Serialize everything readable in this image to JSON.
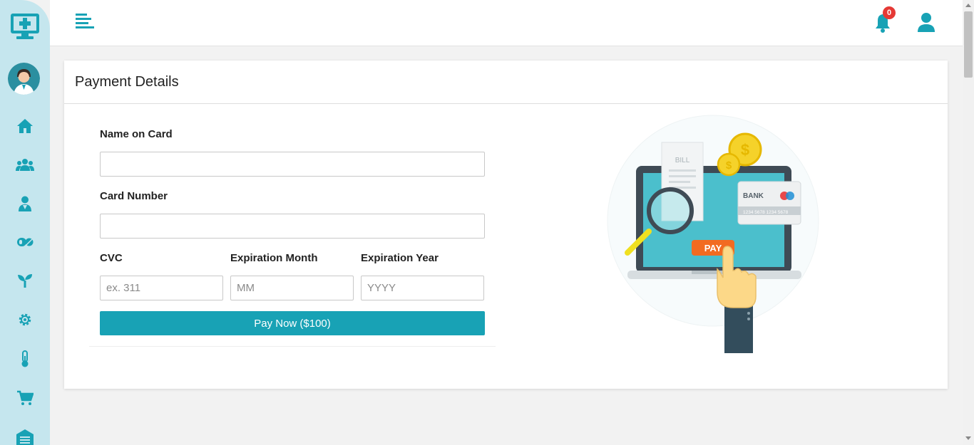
{
  "header": {
    "notification_count": "0"
  },
  "sidebar": {
    "items": [
      {
        "icon": "home-icon"
      },
      {
        "icon": "users-icon"
      },
      {
        "icon": "doctor-icon"
      },
      {
        "icon": "pills-icon"
      },
      {
        "icon": "seedling-icon"
      },
      {
        "icon": "gear-icon"
      },
      {
        "icon": "thermometer-icon"
      },
      {
        "icon": "cart-icon"
      },
      {
        "icon": "warehouse-icon"
      }
    ]
  },
  "card": {
    "title": "Payment Details"
  },
  "form": {
    "name_label": "Name on Card",
    "name_value": "",
    "card_number_label": "Card Number",
    "card_number_value": "",
    "cvc_label": "CVC",
    "cvc_placeholder": "ex. 311",
    "month_label": "Expiration Month",
    "month_placeholder": "MM",
    "year_label": "Expiration Year",
    "year_placeholder": "YYYY",
    "pay_button": "Pay Now ($100)"
  },
  "illustration": {
    "bill_text": "BILL",
    "bank_text": "BANK",
    "card_digits": "1234 5678 1234 5678",
    "pay_text": "PAY"
  },
  "colors": {
    "accent": "#18a2b5",
    "sidebar_bg": "#c5e6ee",
    "badge": "#e53935"
  }
}
